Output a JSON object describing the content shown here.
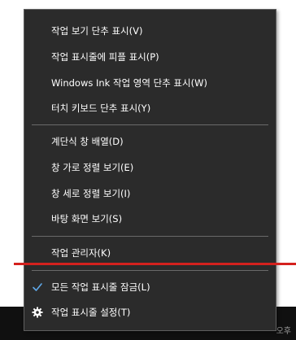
{
  "taskbar": {
    "clock_fragment": "오후"
  },
  "menu": {
    "items": [
      {
        "label": "작업 보기 단추 표시(V)",
        "icon": ""
      },
      {
        "label": "작업 표시줄에 피플 표시(P)",
        "icon": ""
      },
      {
        "label": "Windows Ink 작업 영역 단추 표시(W)",
        "icon": ""
      },
      {
        "label": "터치 키보드 단추 표시(Y)",
        "icon": ""
      },
      {
        "label": "계단식 창 배열(D)",
        "icon": ""
      },
      {
        "label": "창 가로 정렬 보기(E)",
        "icon": ""
      },
      {
        "label": "창 세로 정렬 보기(I)",
        "icon": ""
      },
      {
        "label": "바탕 화면 보기(S)",
        "icon": ""
      },
      {
        "label": "작업 관리자(K)",
        "icon": ""
      },
      {
        "label": "모든 작업 표시줄 잠금(L)",
        "icon": "checkmark-icon"
      },
      {
        "label": "작업 표시줄 설정(T)",
        "icon": "gear-icon"
      }
    ]
  },
  "colors": {
    "menu_background": "#2b2b2b",
    "menu_text": "#ffffff",
    "separator": "#6a6a6a",
    "checkmark": "#5fa8e8",
    "highlight_line": "#d4211e",
    "taskbar": "#101010"
  }
}
